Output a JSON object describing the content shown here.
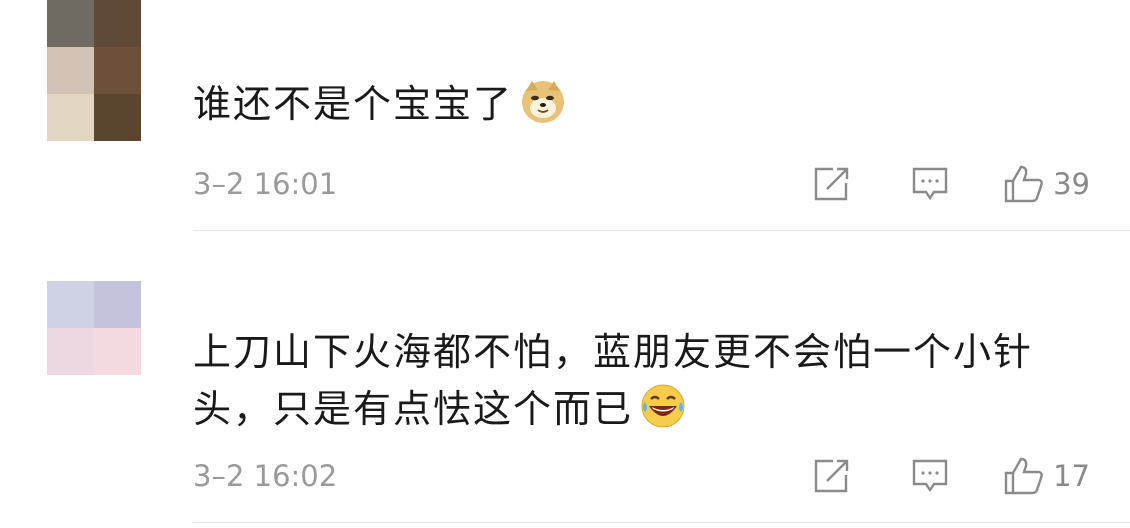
{
  "comments": [
    {
      "text": "谁还不是个宝宝了",
      "emoji": "doge-emoji",
      "time": "3–2 16:01",
      "likes": "39"
    },
    {
      "text_line1": "上刀山下火海都不怕，蓝朋友更不会怕一个小针",
      "text_line2": "头，只是有点怯这个而已",
      "emoji": "laugh-cry-emoji",
      "time": "3–2 16:02",
      "likes": "17"
    }
  ],
  "colors": {
    "text": "#1a1a1a",
    "meta": "#9a9a9a",
    "icon": "#8a8a8a",
    "divider": "#e6e6e6"
  },
  "icons": [
    "share-icon",
    "reply-icon",
    "like-icon"
  ]
}
